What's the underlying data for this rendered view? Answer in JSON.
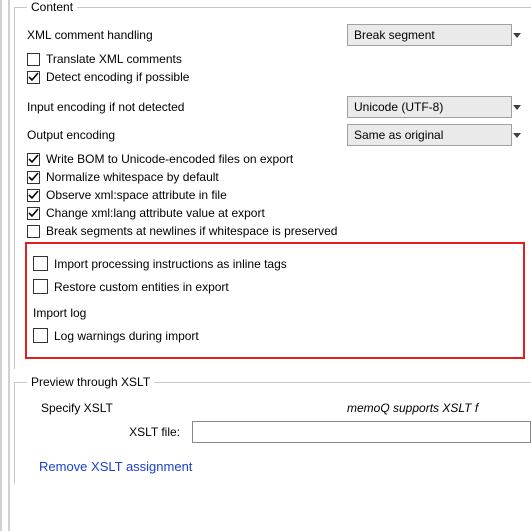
{
  "content": {
    "legend": "Content",
    "xml_comment_label": "XML comment handling",
    "xml_comment_value": "Break segment",
    "translate_xml_comments": "Translate XML comments",
    "detect_encoding": "Detect encoding if possible",
    "input_encoding_label": "Input encoding if not detected",
    "input_encoding_value": "Unicode (UTF-8)",
    "output_encoding_label": "Output encoding",
    "output_encoding_value": "Same as original",
    "write_bom": "Write BOM to Unicode-encoded files on export",
    "normalize_ws": "Normalize whitespace by default",
    "observe_xmlspace": "Observe xml:space attribute in file",
    "change_xmllang": "Change xml:lang attribute value at export",
    "break_newlines": "Break segments at newlines if whitespace is preserved",
    "import_pi": "Import processing instructions as inline tags",
    "restore_entities": "Restore custom entities in export",
    "import_log_heading": "Import log",
    "log_warnings": "Log warnings during import"
  },
  "xslt": {
    "legend": "Preview through XSLT",
    "specify_xslt": "Specify XSLT",
    "note": "memoQ supports XSLT f",
    "file_label": "XSLT file:",
    "remove_link": "Remove XSLT assignment"
  }
}
